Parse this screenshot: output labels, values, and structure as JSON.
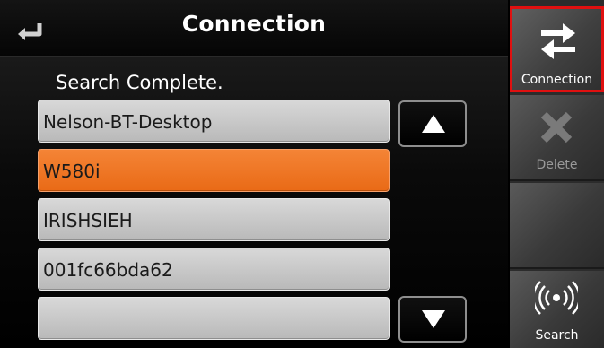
{
  "header": {
    "title": "Connection",
    "back_icon": "return-arrow-icon"
  },
  "main": {
    "status_text": "Search Complete.",
    "devices": [
      {
        "name": "Nelson-BT-Desktop",
        "selected": false
      },
      {
        "name": "W580i",
        "selected": true
      },
      {
        "name": "IRISHSIEH",
        "selected": false
      },
      {
        "name": "001fc66bda62",
        "selected": false
      },
      {
        "name": "",
        "selected": false
      }
    ],
    "scroll_up_icon": "triangle-up-icon",
    "scroll_down_icon": "triangle-down-icon"
  },
  "sidebar": {
    "connection": {
      "label": "Connection",
      "icon": "swap-arrows-icon",
      "active": true
    },
    "delete": {
      "label": "Delete",
      "icon": "x-icon",
      "enabled": false
    },
    "blank": {
      "label": ""
    },
    "search": {
      "label": "Search",
      "icon": "signal-waves-icon"
    }
  },
  "colors": {
    "selected_item": "#f07a2a",
    "item": "#c8c8c8",
    "active_outline": "#e01010"
  }
}
